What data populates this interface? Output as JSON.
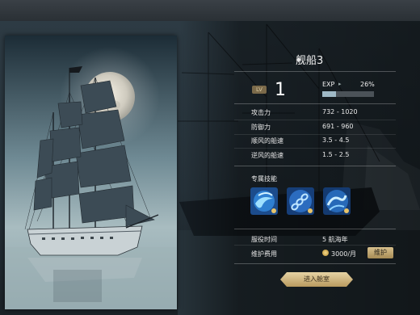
{
  "ship": {
    "name": "舰船3"
  },
  "level": {
    "badge": "LV",
    "value": "1"
  },
  "exp": {
    "label": "EXP",
    "arrow": "▸",
    "percent_text": "26%",
    "fraction": 0.26
  },
  "stats": [
    {
      "label": "攻击力",
      "value": "732 - 1020"
    },
    {
      "label": "防御力",
      "value": "691 - 960"
    },
    {
      "label": "顺风的船速",
      "value": "3.5 - 4.5"
    },
    {
      "label": "逆风的船速",
      "value": "1.5 - 2.5"
    }
  ],
  "skills": {
    "header": "专属技能",
    "items": [
      {
        "icon": "water-swirl-skill-icon"
      },
      {
        "icon": "chain-skill-icon"
      },
      {
        "icon": "wave-skill-icon"
      }
    ]
  },
  "service": {
    "time_label": "服役时间",
    "time_value": "5 航海年",
    "cost_label": "维护费用",
    "cost_value": "3000/月",
    "maintain_button": "维护"
  },
  "enter_button": "进入舱室",
  "colors": {
    "gold": "#cdb57f",
    "exp_fill": "#9fb9c6",
    "panel_bg": "#1d262c"
  }
}
